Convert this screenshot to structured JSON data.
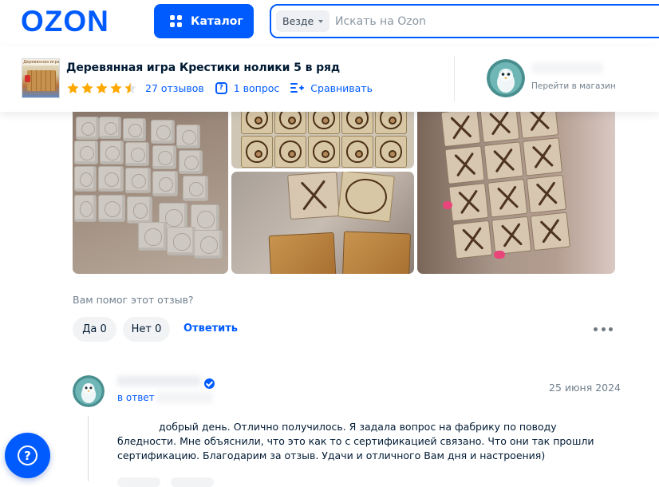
{
  "header": {
    "logo": "OZON",
    "catalog_label": "Каталог",
    "search_scope": "Везде",
    "search_placeholder": "Искать на Ozon"
  },
  "product": {
    "title": "Деревянная игра Крестики нолики 5 в ряд",
    "rating": 4.5,
    "reviews": "27 отзывов",
    "questions": "1 вопрос",
    "compare": "Сравнивать",
    "shop_link": "Перейти в магазин",
    "thumbnail_text": "Деревянная игра"
  },
  "review_actions": {
    "question": "Вам помог этот отзыв?",
    "yes": "Да 0",
    "no": "Нет 0",
    "answer": "Ответить"
  },
  "reply": {
    "to": "в ответ",
    "date": "25 июня 2024",
    "text": "добрый день. Отлично получилось. Я задала вопрос на фабрику по поводу бледности. Мне объяснили, что это как то с сертификацией связано. Что они так прошли сертификацию. Благодарим за отзыв. Удачи и отличного Вам дня и настроения)"
  },
  "icons": {
    "catalog": "grid-icon",
    "star": "star-icon",
    "question": "question-icon",
    "compare": "compare-icon",
    "more": "more-dots-icon",
    "support": "help-icon"
  },
  "colors": {
    "brand": "#005bff",
    "star": "#ffa800",
    "text": "#001a34",
    "muted": "#707f8d"
  }
}
